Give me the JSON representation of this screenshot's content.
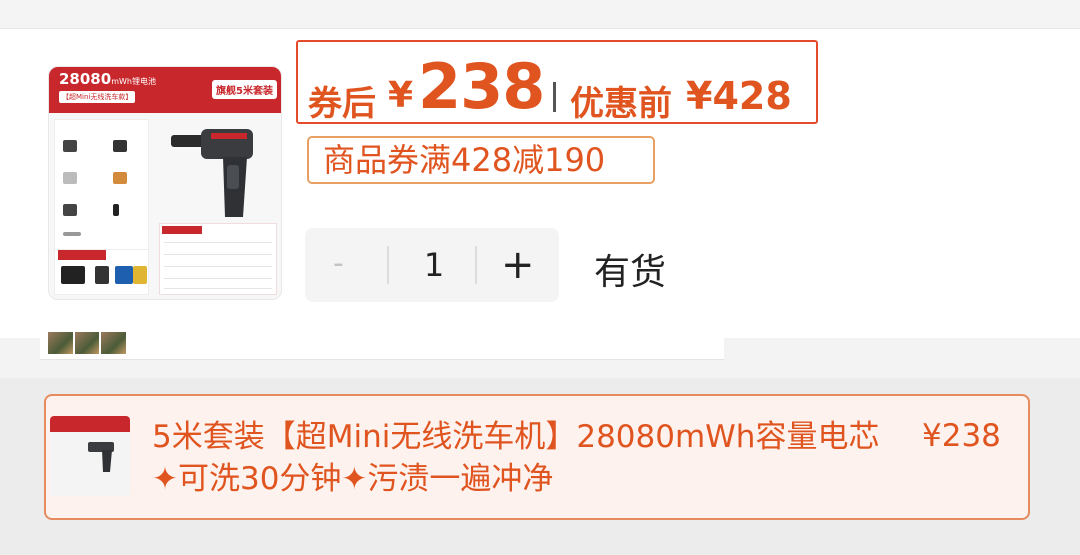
{
  "product": {
    "image_capacity": "28080",
    "image_capacity_unit": "mWh锂电池",
    "image_subtitle": "【超Mini无线洗车款】",
    "image_flag": "旗舰5米套装"
  },
  "price": {
    "after_coupon_label": "券后",
    "currency": "¥",
    "after_coupon_value": "238",
    "before_label": "优惠前",
    "before_value": "¥428"
  },
  "coupon": {
    "text": "商品券满428减190"
  },
  "quantity": {
    "minus": "-",
    "value": "1",
    "plus": "+"
  },
  "stock_status": "有货",
  "selected_variant": {
    "title": "5米套装【超Mini无线洗车机】28080mWh容量电芯✦可洗30分钟✦污渍一遍冲净",
    "price": "¥238"
  },
  "colors": {
    "accent": "#e0541f",
    "border_red": "#e54b2a",
    "coupon_border": "#e8a163",
    "brand_red": "#c8282c"
  }
}
